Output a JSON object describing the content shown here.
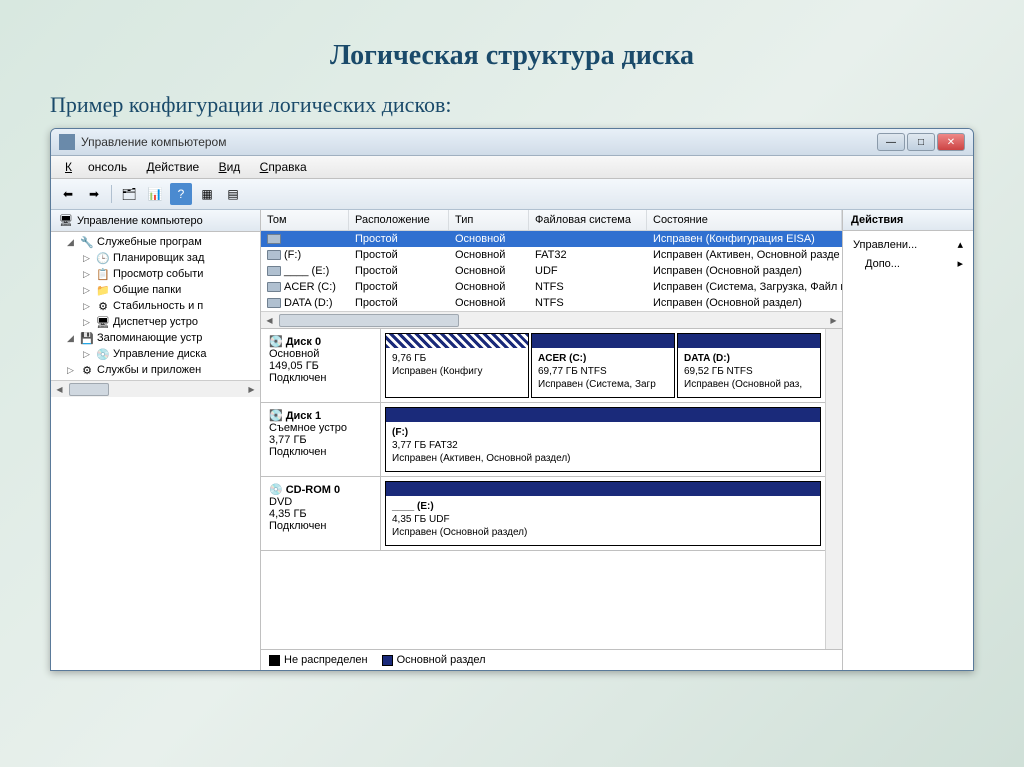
{
  "slide": {
    "title": "Логическая структура диска",
    "subtitle": "Пример конфигурации логических дисков:"
  },
  "window": {
    "title": "Управление компьютером"
  },
  "menu": {
    "console": "Консоль",
    "action": "Действие",
    "view": "Вид",
    "help": "Справка"
  },
  "tree": {
    "root": "Управление компьютеро",
    "items": [
      {
        "label": "Служебные програм",
        "expanded": true,
        "icon": "🔧"
      },
      {
        "label": "Планировщик зад",
        "level": 2,
        "icon": "🕒"
      },
      {
        "label": "Просмотр событи",
        "level": 2,
        "icon": "📋"
      },
      {
        "label": "Общие папки",
        "level": 2,
        "icon": "📁"
      },
      {
        "label": "Стабильность и п",
        "level": 2,
        "icon": "⚙"
      },
      {
        "label": "Диспетчер устро",
        "level": 2,
        "icon": "🖥"
      },
      {
        "label": "Запоминающие устр",
        "level": 1,
        "expanded": true,
        "icon": "💾"
      },
      {
        "label": "Управление диска",
        "level": 2,
        "icon": "💿"
      },
      {
        "label": "Службы и приложен",
        "level": 1,
        "icon": "⚙"
      }
    ]
  },
  "volumes": {
    "headers": {
      "tom": "Том",
      "rasp": "Расположение",
      "tip": "Тип",
      "fs": "Файловая система",
      "state": "Состояние"
    },
    "rows": [
      {
        "name": "",
        "rasp": "Простой",
        "tip": "Основной",
        "fs": "",
        "state": "Исправен (Конфигурация EISA)",
        "selected": true
      },
      {
        "name": "(F:)",
        "rasp": "Простой",
        "tip": "Основной",
        "fs": "FAT32",
        "state": "Исправен (Активен, Основной разде"
      },
      {
        "name": "____ (E:)",
        "rasp": "Простой",
        "tip": "Основной",
        "fs": "UDF",
        "state": "Исправен (Основной раздел)"
      },
      {
        "name": "ACER (C:)",
        "rasp": "Простой",
        "tip": "Основной",
        "fs": "NTFS",
        "state": "Исправен (Система, Загрузка, Файл п"
      },
      {
        "name": "DATA (D:)",
        "rasp": "Простой",
        "tip": "Основной",
        "fs": "NTFS",
        "state": "Исправен (Основной раздел)"
      }
    ]
  },
  "disks": [
    {
      "name": "Диск 0",
      "type": "Основной",
      "size": "149,05 ГБ",
      "status": "Подключен",
      "icon": "💽",
      "parts": [
        {
          "title": "",
          "size": "9,76 ГБ",
          "info": "Исправен (Конфигу",
          "hatch": true
        },
        {
          "title": "ACER  (C:)",
          "size": "69,77 ГБ NTFS",
          "info": "Исправен (Система, Загр"
        },
        {
          "title": "DATA  (D:)",
          "size": "69,52 ГБ NTFS",
          "info": "Исправен (Основной раз,"
        }
      ]
    },
    {
      "name": "Диск 1",
      "type": "Съемное устро",
      "size": "3,77 ГБ",
      "status": "Подключен",
      "icon": "💽",
      "parts": [
        {
          "title": "(F:)",
          "size": "3,77 ГБ FAT32",
          "info": "Исправен (Активен, Основной раздел)"
        }
      ]
    },
    {
      "name": "CD-ROM 0",
      "type": "DVD",
      "size": "4,35 ГБ",
      "status": "Подключен",
      "icon": "💿",
      "parts": [
        {
          "title": "____ (E:)",
          "size": "4,35 ГБ UDF",
          "info": "Исправен (Основной раздел)"
        }
      ]
    }
  ],
  "legend": {
    "unalloc": "Не распределен",
    "primary": "Основной раздел"
  },
  "actions": {
    "header": "Действия",
    "item1": "Управлени...",
    "item2": "Допо..."
  }
}
